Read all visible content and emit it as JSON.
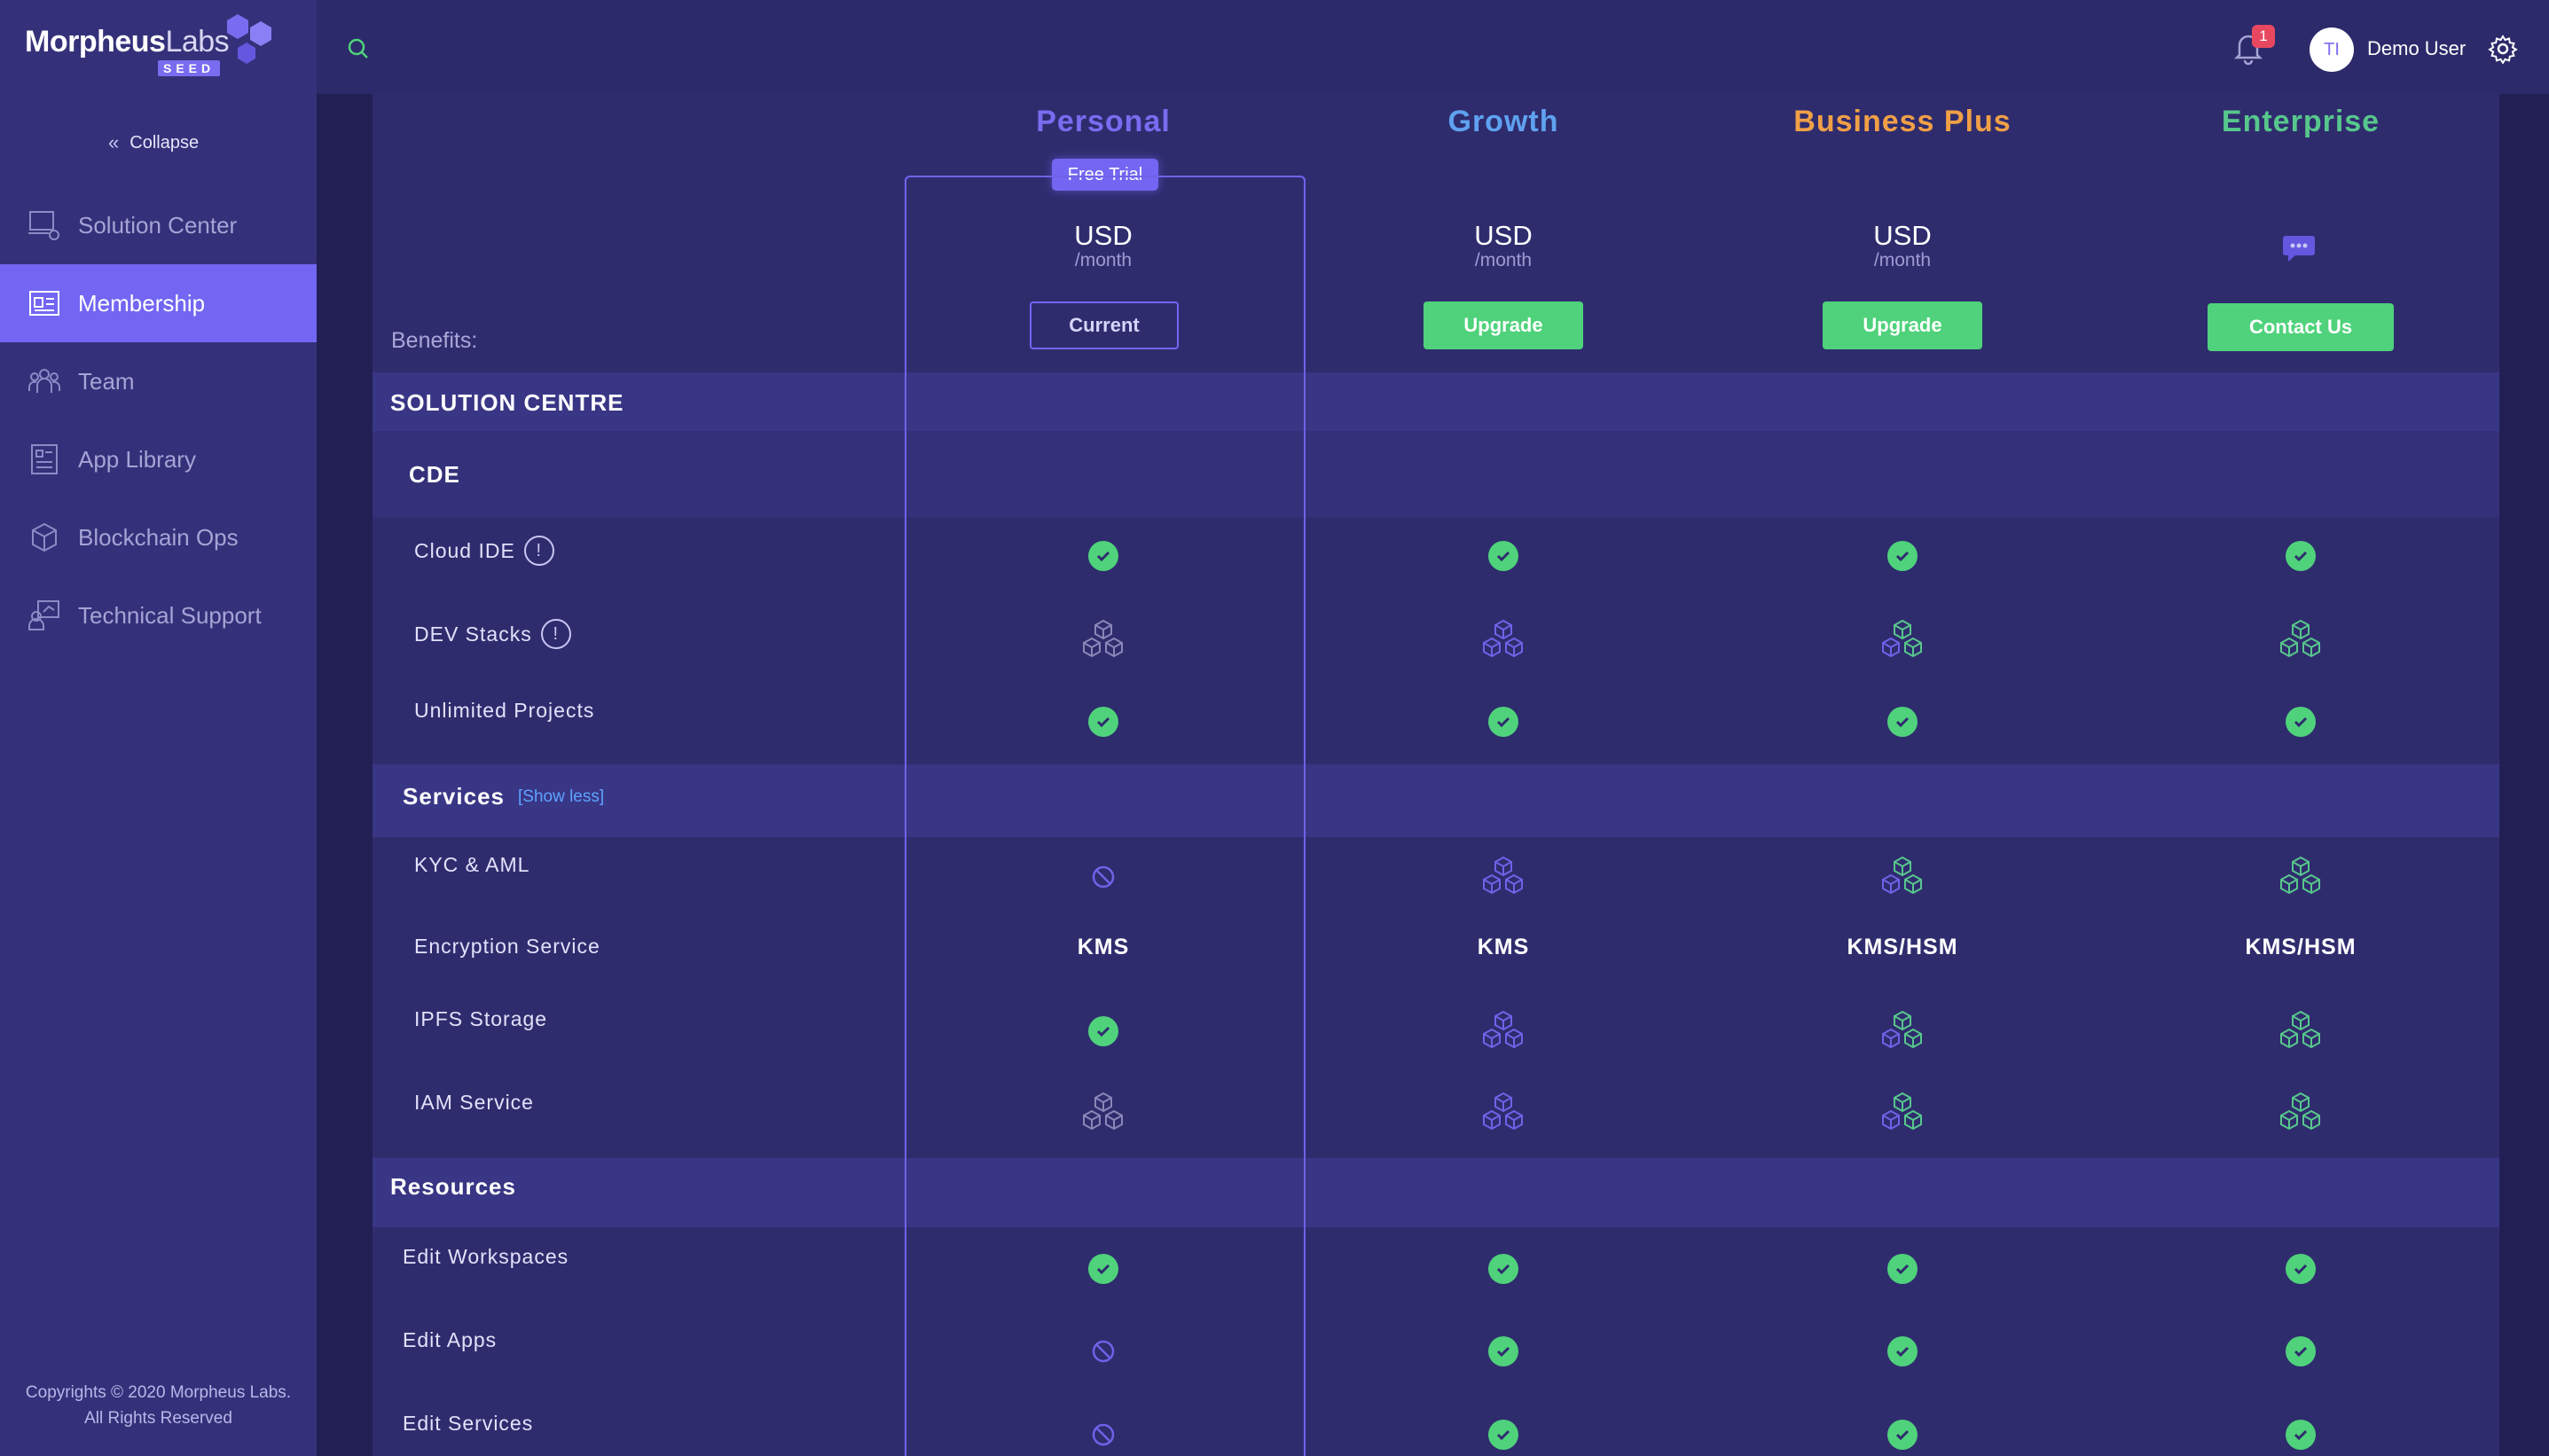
{
  "brand": {
    "name_bold": "Morpheus",
    "name_light": "Labs",
    "edition": "SEED"
  },
  "sidebar": {
    "collapse_label": "Collapse",
    "items": [
      {
        "label": "Solution Center",
        "icon": "solution-center-icon",
        "active": false
      },
      {
        "label": "Membership",
        "icon": "membership-icon",
        "active": true
      },
      {
        "label": "Team",
        "icon": "team-icon",
        "active": false
      },
      {
        "label": "App Library",
        "icon": "app-library-icon",
        "active": false
      },
      {
        "label": "Blockchain Ops",
        "icon": "blockchain-ops-icon",
        "active": false
      },
      {
        "label": "Technical Support",
        "icon": "technical-support-icon",
        "active": false
      }
    ],
    "copyright_line1": "Copyrights © 2020 Morpheus Labs.",
    "copyright_line2": "All Rights Reserved"
  },
  "topbar": {
    "notification_count": "1",
    "avatar_initials": "TI",
    "user_name": "Demo User"
  },
  "colors": {
    "accent": "#7266f2",
    "green": "#4fd27b",
    "personal": "#7a6cf0",
    "growth": "#5fa2f0",
    "business_plus": "#f0a046",
    "enterprise": "#57c78c"
  },
  "plans": [
    {
      "name": "Personal",
      "currency": "USD",
      "period": "/month",
      "button": "Current",
      "badge": "Free Trial"
    },
    {
      "name": "Growth",
      "currency": "USD",
      "period": "/month",
      "button": "Upgrade"
    },
    {
      "name": "Business Plus",
      "currency": "USD",
      "period": "/month",
      "button": "Upgrade"
    },
    {
      "name": "Enterprise",
      "icon": "chat-icon",
      "button": "Contact Us"
    }
  ],
  "table": {
    "benefits_label": "Benefits:",
    "sections": {
      "solution_centre": "SOLUTION CENTRE",
      "cde": "CDE",
      "services": "Services",
      "show_less": "[Show less]",
      "resources": "Resources"
    },
    "rows": {
      "cloud_ide": {
        "label": "Cloud IDE",
        "cells": [
          "check",
          "check",
          "check",
          "check"
        ]
      },
      "dev_stacks": {
        "label": "DEV Stacks",
        "cells": [
          "cubes-gray",
          "cubes-purple",
          "cubes-mixed",
          "cubes-green"
        ]
      },
      "unlimited_projects": {
        "label": "Unlimited Projects",
        "cells": [
          "check",
          "check",
          "check",
          "check"
        ]
      },
      "kyc_aml": {
        "label": "KYC & AML",
        "cells": [
          "na",
          "cubes-purple",
          "cubes-mixed",
          "cubes-green"
        ]
      },
      "encryption": {
        "label": "Encryption Service",
        "cells": [
          "KMS",
          "KMS",
          "KMS/HSM",
          "KMS/HSM"
        ]
      },
      "ipfs": {
        "label": "IPFS Storage",
        "cells": [
          "check",
          "cubes-purple",
          "cubes-mixed",
          "cubes-green"
        ]
      },
      "iam": {
        "label": "IAM Service",
        "cells": [
          "cubes-gray",
          "cubes-purple",
          "cubes-mixed",
          "cubes-green"
        ]
      },
      "edit_workspaces": {
        "label": "Edit Workspaces",
        "cells": [
          "check",
          "check",
          "check",
          "check"
        ]
      },
      "edit_apps": {
        "label": "Edit Apps",
        "cells": [
          "na",
          "check",
          "check",
          "check"
        ]
      },
      "edit_services": {
        "label": "Edit Services",
        "cells": [
          "na",
          "check",
          "check",
          "check"
        ]
      }
    }
  }
}
